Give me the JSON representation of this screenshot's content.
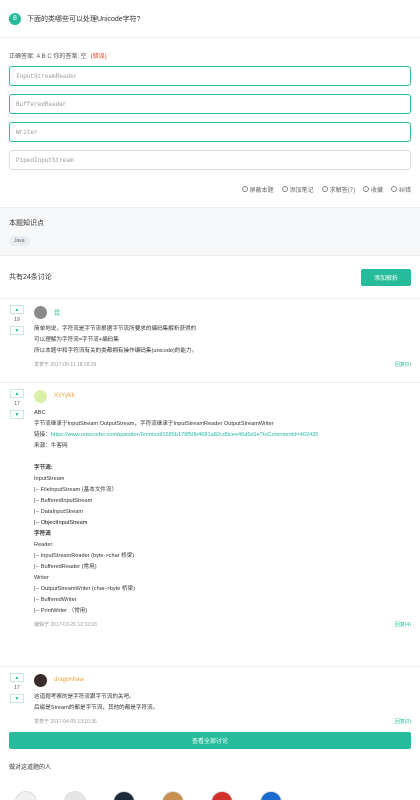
{
  "question": {
    "number": "8",
    "text": "下面的类哪些可以处理Unicode字符?"
  },
  "answer": {
    "label": "正确答案: A B C   你的答案: 空",
    "status": "(错误)"
  },
  "options": [
    "InputStreamReader",
    "BufferedReader",
    "Writer",
    "PipedInputStream"
  ],
  "tools": [
    "屏蔽本题",
    "添加笔记",
    "求解答(7)",
    "收藏",
    "纠错"
  ],
  "knowledge": {
    "title": "本题知识点",
    "tag": "Java"
  },
  "discussion": {
    "title": "共有24条讨论",
    "add_button": "添加解析"
  },
  "posts": [
    {
      "votes": "19",
      "author": "昆.",
      "author_color": "#25bb9b",
      "lines": [
        "简单地说，字符流是字节流根据字节流所要求的编码集解析获得的",
        "可以理解为字符流=字节流+编码集",
        "所以本题中和字符流有关的类都拥有操作编码集(unicode)的能力。"
      ],
      "time": "发表于 2017-05-11 18:28:29",
      "reply": "回复(0)"
    },
    {
      "votes": "17",
      "author": "XxYyKk",
      "author_color": "#e8a23a",
      "lines": [
        "ABC",
        "字节流继承于InputStream OutputStream，字符流继承于InputStreamReader OutputStreamWriter"
      ],
      "link_label": "链接：",
      "link": "https://www.nowcoder.com/questionTerminal/1585b178f50b4681a82cd9cee46d6d1e?toCommentId=402435",
      "source": "来源：牛客网",
      "section1": "字节流:",
      "s1": [
        "InputStream",
        "|-- FileInputStream (基本文件流）",
        "|-- BufferedInputStream",
        "|-- DataInputStream"
      ],
      "s1b": "|-- ObjectInputStream",
      "section2": "字符流",
      "s2": [
        "Reader",
        "|-- InputStreamReader (byte->char 桥梁)",
        "|-- BufferedReader (常用)",
        "Writer",
        "|-- OutputStreamWriter (char->byte 桥梁)",
        "|-- BufferedWriter",
        "|-- PrintWriter （常用)"
      ],
      "time": "编辑于 2017-03-26 12:32:03",
      "reply": "回复(4)"
    },
    {
      "votes": "17",
      "author": "dragonhaw",
      "author_color": "#e8a23a",
      "lines": [
        "这道题考察的是字符流跟字节流的关吧。",
        "后缀是Stream的都是字节流，其他的都是字符流。"
      ],
      "time": "发表于 2017-04-09 13:10:36",
      "reply": "回复(0)"
    }
  ],
  "all_button": "查看全部讨论",
  "people_title": "做对这道题的人"
}
